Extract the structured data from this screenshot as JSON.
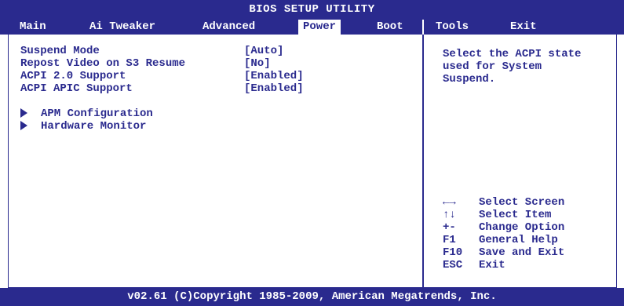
{
  "title": "BIOS SETUP UTILITY",
  "tabs": [
    "Main",
    "Ai Tweaker",
    "Advanced",
    "Power",
    "Boot",
    "Tools",
    "Exit"
  ],
  "active_tab": "Power",
  "settings": [
    {
      "label": "Suspend Mode",
      "value": "[Auto]"
    },
    {
      "label": "Repost Video on S3 Resume",
      "value": "[No]"
    },
    {
      "label": "ACPI 2.0 Support",
      "value": "[Enabled]"
    },
    {
      "label": "ACPI APIC Support",
      "value": "[Enabled]"
    }
  ],
  "submenus": [
    "APM Configuration",
    "Hardware Monitor"
  ],
  "help_text": "Select the ACPI state\nused for System\nSuspend.",
  "keys": [
    {
      "key": "←→",
      "desc": "Select Screen"
    },
    {
      "key": "↑↓",
      "desc": "Select Item"
    },
    {
      "key": "+-",
      "desc": "Change Option"
    },
    {
      "key": "F1",
      "desc": "General Help"
    },
    {
      "key": "F10",
      "desc": "Save and Exit"
    },
    {
      "key": "ESC",
      "desc": "Exit"
    }
  ],
  "footer": "v02.61 (C)Copyright 1985-2009, American Megatrends, Inc.",
  "colors": {
    "primary": "#2a2a8e",
    "background": "#ffffff"
  }
}
